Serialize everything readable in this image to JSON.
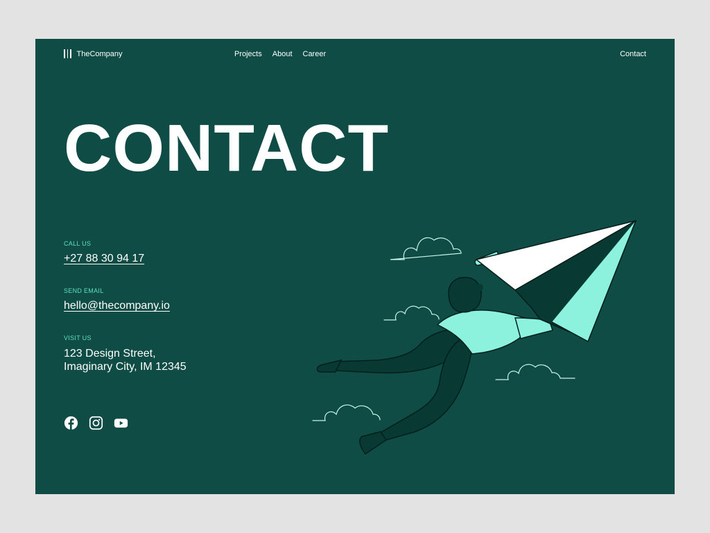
{
  "nav": {
    "brand": "TheCompany",
    "links": [
      "Projects",
      "About",
      "Career"
    ],
    "contact": "Contact"
  },
  "hero": {
    "title": "CONTACT"
  },
  "contact_info": {
    "phone": {
      "label": "CALL US",
      "value": "+27 88 30 94 17"
    },
    "email": {
      "label": "SEND EMAIL",
      "value": "hello@thecompany.io"
    },
    "address": {
      "label": "VISIT US",
      "value": "123 Design Street,\nImaginary City, IM 12345"
    }
  },
  "social": [
    "facebook-icon",
    "instagram-icon",
    "youtube-icon"
  ],
  "colors": {
    "background": "#0f4c45",
    "accent": "#5fe0c0",
    "mint": "#8cf2dd",
    "dark": "#083a33",
    "page": "#e3e3e3"
  }
}
